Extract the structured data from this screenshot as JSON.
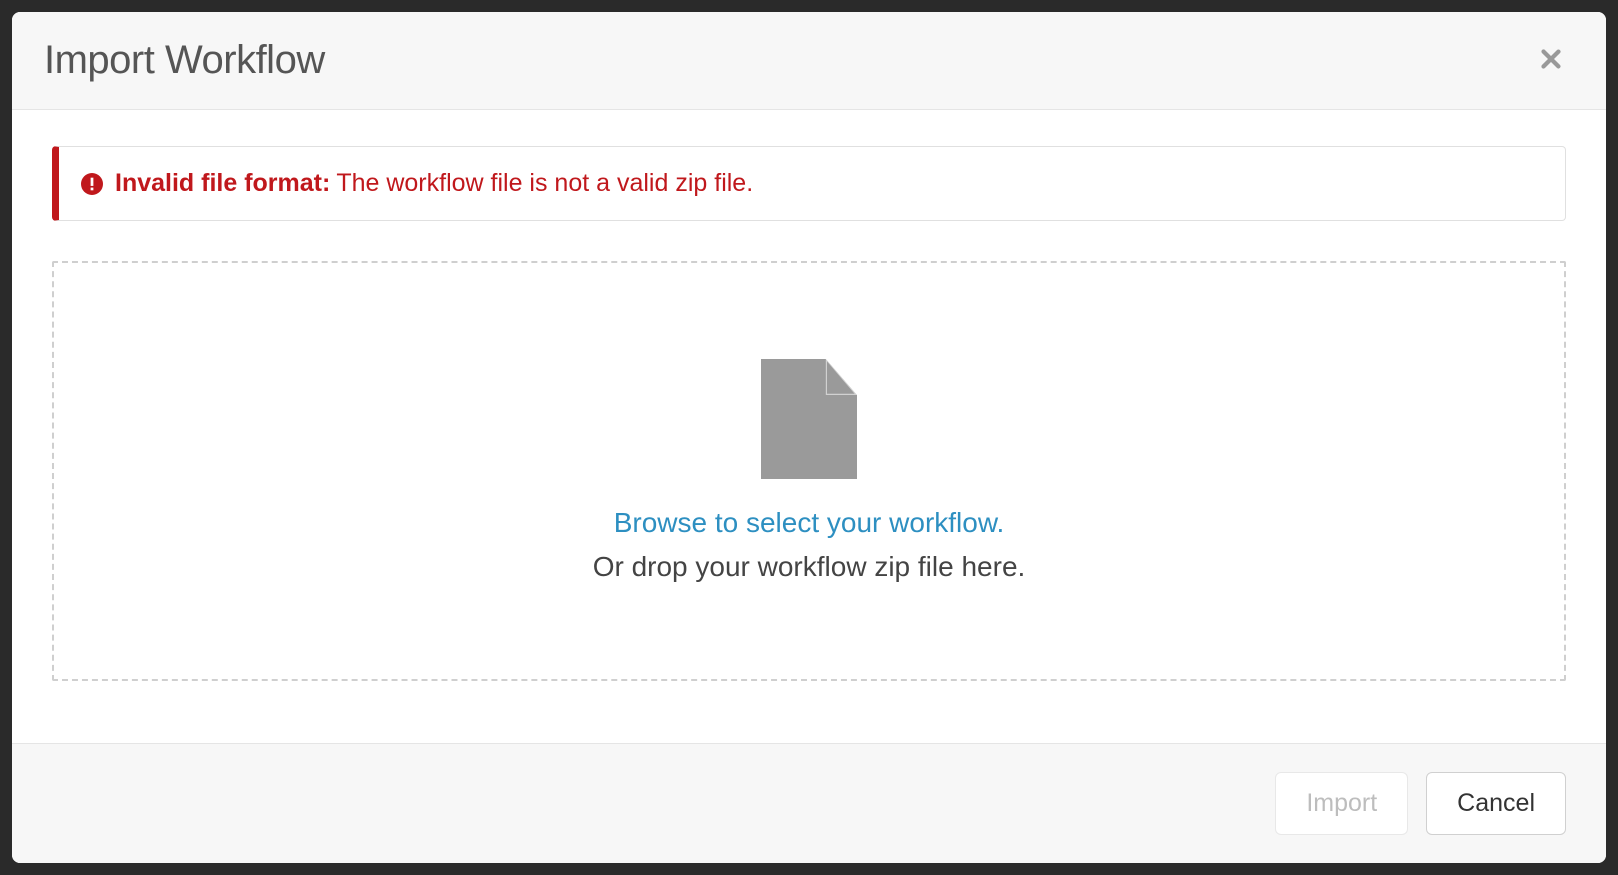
{
  "modal": {
    "title": "Import Workflow"
  },
  "alert": {
    "strong": "Invalid file format:",
    "message": "The workflow file is not a valid zip file."
  },
  "dropzone": {
    "browse": "Browse to select your workflow.",
    "drop": "Or drop your workflow zip file here."
  },
  "footer": {
    "import": "Import",
    "cancel": "Cancel"
  }
}
